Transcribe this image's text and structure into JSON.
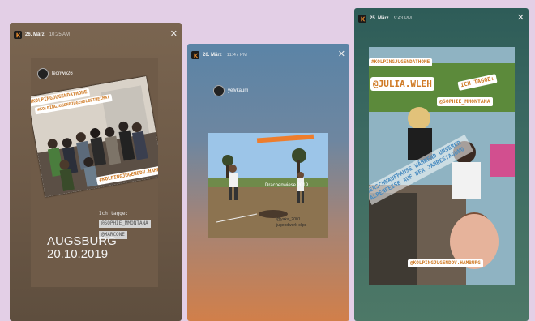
{
  "stories": [
    {
      "date": "26. März",
      "time": "10:25 AM",
      "username": "leonwo26",
      "tags": [
        "#KOLPINGJUGENDATHOME",
        "#KOLPINGJUGENDJUGENDLEBTHEIMAT",
        "#KOLPINGJUGENDDV.HAMBURG"
      ],
      "tag_label": "Ich tagge:",
      "tagged_users": [
        "@SOPHIE_MMONTANA",
        "@MARCONE"
      ],
      "event_place": "AUGSBURG",
      "event_date": "20.10.2019"
    },
    {
      "date": "26. März",
      "time": "11:47 PM",
      "username": "yelvkaum",
      "photo_text": "Drachenwiese 2019",
      "photo_caption_line1": "@yaka_2001",
      "photo_caption_line2": "jugendwerk-clips"
    },
    {
      "date": "25. März",
      "time": "9:43 PM",
      "tag_main": "#KOLPINGJUGENDATHOME",
      "mention_1": "@JULIA.WLEH",
      "mention_tag_label": "ICH TAGGE:",
      "mention_2": "@SOPHIE_MMONTANA",
      "tilted_text": "VERSCHNAUFPAUSE WÄHREND UNSERER ALPENREISE AUF DER JAHRESTAGUNG",
      "tag_bottom": "@KOLPINGJUGENDDV.HAMBURG"
    }
  ],
  "icons": {
    "logo": "kolping-k-logo",
    "close": "close-icon"
  },
  "colors": {
    "tag_text": "#d07b26",
    "tag_bg": "#ffffff"
  }
}
